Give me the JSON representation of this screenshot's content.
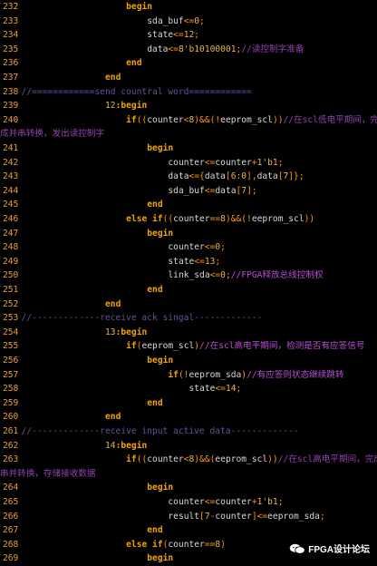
{
  "lines": [
    {
      "n": "232",
      "indent": 22,
      "t": [
        [
          "kw",
          "begin"
        ]
      ]
    },
    {
      "n": "233",
      "indent": 26,
      "t": [
        [
          "id",
          "sda_buf"
        ],
        [
          "op",
          "<="
        ],
        [
          "nm",
          "0"
        ],
        [
          "op",
          ";"
        ]
      ]
    },
    {
      "n": "234",
      "indent": 26,
      "t": [
        [
          "id",
          "state"
        ],
        [
          "op",
          "<="
        ],
        [
          "nm",
          "12"
        ],
        [
          "op",
          ";"
        ]
      ]
    },
    {
      "n": "235",
      "indent": 26,
      "t": [
        [
          "id",
          "data"
        ],
        [
          "op",
          "<="
        ],
        [
          "nm",
          "8'b10100001"
        ],
        [
          "op",
          ";"
        ],
        [
          "cm",
          "//读控制字准备"
        ]
      ]
    },
    {
      "n": "236",
      "indent": 22,
      "t": [
        [
          "kw",
          "end"
        ]
      ]
    },
    {
      "n": "237",
      "indent": 18,
      "t": [
        [
          "kw",
          "end"
        ]
      ]
    },
    {
      "n": "238",
      "indent": 2,
      "t": [
        [
          "sep",
          "//============send countral word============"
        ]
      ]
    },
    {
      "n": "239",
      "indent": 18,
      "t": [
        [
          "nm",
          "12"
        ],
        [
          "kw",
          ":begin"
        ]
      ]
    },
    {
      "n": "240",
      "indent": 22,
      "t": [
        [
          "kw",
          "if"
        ],
        [
          "op",
          "(("
        ],
        [
          "id",
          "counter"
        ],
        [
          "op",
          "<"
        ],
        [
          "nm",
          "8"
        ],
        [
          "op",
          ")&&(!"
        ],
        [
          "id",
          "eeprom_scl"
        ],
        [
          "op",
          "))"
        ],
        [
          "cm",
          "//在scl低电平期间，完"
        ]
      ]
    },
    {
      "wrap": "成并串转换，发出读控制字"
    },
    {
      "n": "241",
      "indent": 26,
      "t": [
        [
          "kw",
          "begin"
        ]
      ]
    },
    {
      "n": "242",
      "indent": 30,
      "t": [
        [
          "id",
          "counter"
        ],
        [
          "op",
          "<="
        ],
        [
          "id",
          "counter"
        ],
        [
          "op",
          "+"
        ],
        [
          "nm",
          "1'b1"
        ],
        [
          "op",
          ";"
        ]
      ]
    },
    {
      "n": "243",
      "indent": 30,
      "t": [
        [
          "id",
          "data"
        ],
        [
          "op",
          "<={"
        ],
        [
          "id",
          "data"
        ],
        [
          "op",
          "["
        ],
        [
          "nm",
          "6:0"
        ],
        [
          "op",
          "],"
        ],
        [
          "id",
          "data"
        ],
        [
          "op",
          "["
        ],
        [
          "nm",
          "7"
        ],
        [
          "op",
          "]};"
        ]
      ]
    },
    {
      "n": "244",
      "indent": 30,
      "t": [
        [
          "id",
          "sda_buf"
        ],
        [
          "op",
          "<="
        ],
        [
          "id",
          "data"
        ],
        [
          "op",
          "["
        ],
        [
          "nm",
          "7"
        ],
        [
          "op",
          "];"
        ]
      ]
    },
    {
      "n": "245",
      "indent": 26,
      "t": [
        [
          "kw",
          "end"
        ]
      ]
    },
    {
      "n": "246",
      "indent": 22,
      "t": [
        [
          "kw",
          "else if"
        ],
        [
          "op",
          "(("
        ],
        [
          "id",
          "counter"
        ],
        [
          "op",
          "=="
        ],
        [
          "nm",
          "8"
        ],
        [
          "op",
          ")&&(!"
        ],
        [
          "id",
          "eeprom_scl"
        ],
        [
          "op",
          "))"
        ]
      ]
    },
    {
      "n": "247",
      "indent": 26,
      "t": [
        [
          "kw",
          "begin"
        ]
      ]
    },
    {
      "n": "248",
      "indent": 30,
      "t": [
        [
          "id",
          "counter"
        ],
        [
          "op",
          "<="
        ],
        [
          "nm",
          "0"
        ],
        [
          "op",
          ";"
        ]
      ]
    },
    {
      "n": "249",
      "indent": 30,
      "t": [
        [
          "id",
          "state"
        ],
        [
          "op",
          "<="
        ],
        [
          "nm",
          "13"
        ],
        [
          "op",
          ";"
        ]
      ]
    },
    {
      "n": "250",
      "indent": 30,
      "t": [
        [
          "id",
          "link_sda"
        ],
        [
          "op",
          "<="
        ],
        [
          "nm",
          "0"
        ],
        [
          "op",
          ";"
        ],
        [
          "cmr",
          "//FPGA释放总线控制权"
        ]
      ]
    },
    {
      "n": "251",
      "indent": 26,
      "t": [
        [
          "kw",
          "end"
        ]
      ]
    },
    {
      "n": "252",
      "indent": 18,
      "t": [
        [
          "kw",
          "end"
        ]
      ]
    },
    {
      "n": "253",
      "indent": 2,
      "t": [
        [
          "sep",
          "//-------------receive ack singal-------------"
        ]
      ]
    },
    {
      "n": "254",
      "indent": 18,
      "t": [
        [
          "nm",
          "13"
        ],
        [
          "kw",
          ":begin"
        ]
      ]
    },
    {
      "n": "255",
      "indent": 22,
      "t": [
        [
          "kw",
          "if"
        ],
        [
          "op",
          "("
        ],
        [
          "id",
          "eeprom_scl"
        ],
        [
          "op",
          ")"
        ],
        [
          "cmr",
          "//在scl高电平期间，检测是否有应答信号"
        ]
      ]
    },
    {
      "n": "256",
      "indent": 26,
      "t": [
        [
          "kw",
          "begin"
        ]
      ]
    },
    {
      "n": "257",
      "indent": 30,
      "t": [
        [
          "kw",
          "if"
        ],
        [
          "op",
          "(!"
        ],
        [
          "id",
          "eeprom_sda"
        ],
        [
          "op",
          ")"
        ],
        [
          "cmr",
          "//有应答则状态继续跳转"
        ]
      ]
    },
    {
      "n": "258",
      "indent": 34,
      "t": [
        [
          "id",
          "state"
        ],
        [
          "op",
          "<="
        ],
        [
          "nm",
          "14"
        ],
        [
          "op",
          ";"
        ]
      ]
    },
    {
      "n": "259",
      "indent": 26,
      "t": [
        [
          "kw",
          "end"
        ]
      ]
    },
    {
      "n": "260",
      "indent": 18,
      "t": [
        [
          "kw",
          "end"
        ]
      ]
    },
    {
      "n": "261",
      "indent": 2,
      "t": [
        [
          "sep",
          "//-------------receive input active data-------------"
        ]
      ]
    },
    {
      "n": "262",
      "indent": 18,
      "t": [
        [
          "nm",
          "14"
        ],
        [
          "kw",
          ":begin"
        ]
      ]
    },
    {
      "n": "263",
      "indent": 22,
      "t": [
        [
          "kw",
          "if"
        ],
        [
          "op",
          "(("
        ],
        [
          "id",
          "counter"
        ],
        [
          "op",
          "<"
        ],
        [
          "nm",
          "8"
        ],
        [
          "op",
          ")&&("
        ],
        [
          "id",
          "eeprom_scl"
        ],
        [
          "op",
          "))"
        ],
        [
          "cm",
          "//在scl高电平期间，完成"
        ]
      ]
    },
    {
      "wrap": "串并转换，存储接收数据"
    },
    {
      "n": "264",
      "indent": 26,
      "t": [
        [
          "kw",
          "begin"
        ]
      ]
    },
    {
      "n": "265",
      "indent": 30,
      "t": [
        [
          "id",
          "counter"
        ],
        [
          "op",
          "<="
        ],
        [
          "id",
          "counter"
        ],
        [
          "op",
          "+"
        ],
        [
          "nm",
          "1'b1"
        ],
        [
          "op",
          ";"
        ]
      ]
    },
    {
      "n": "266",
      "indent": 30,
      "t": [
        [
          "id",
          "result"
        ],
        [
          "op",
          "["
        ],
        [
          "nm",
          "7"
        ],
        [
          "op",
          "-"
        ],
        [
          "id",
          "counter"
        ],
        [
          "op",
          "]<="
        ],
        [
          "id",
          "eeprom_sda"
        ],
        [
          "op",
          ";"
        ]
      ]
    },
    {
      "n": "267",
      "indent": 26,
      "t": [
        [
          "kw",
          "end"
        ]
      ]
    },
    {
      "n": "268",
      "indent": 22,
      "t": [
        [
          "kw",
          "else if"
        ],
        [
          "op",
          "("
        ],
        [
          "id",
          "counter"
        ],
        [
          "op",
          "=="
        ],
        [
          "nm",
          "8"
        ],
        [
          "op",
          ")"
        ]
      ]
    },
    {
      "n": "269",
      "indent": 26,
      "t": [
        [
          "kw",
          "begin"
        ]
      ]
    }
  ],
  "watermark": {
    "label": "FPGA设计论坛",
    "icon": "wechat-icon"
  }
}
